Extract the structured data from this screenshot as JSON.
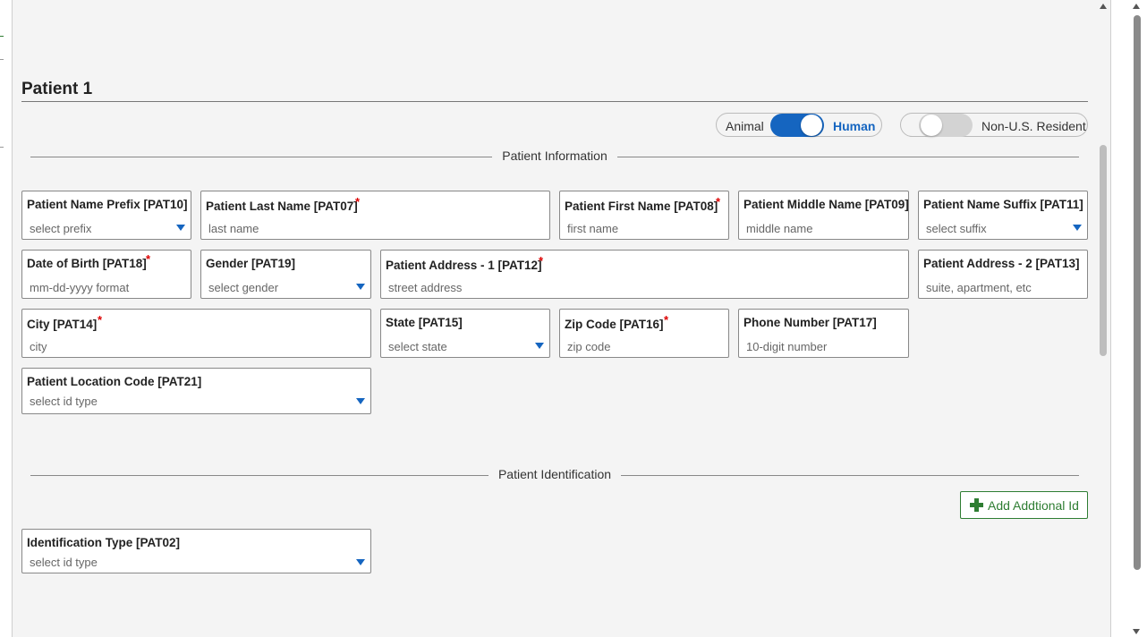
{
  "title": "Patient 1",
  "toggles": {
    "species": {
      "left_label": "Animal",
      "right_label": "Human",
      "on": true
    },
    "residency": {
      "label": "Non-U.S. Resident",
      "on": false
    }
  },
  "sections": {
    "info": "Patient Information",
    "identification": "Patient Identification"
  },
  "fields": {
    "prefix": {
      "label": "Patient Name Prefix [PAT10]",
      "placeholder": "select prefix",
      "required": false
    },
    "last_name": {
      "label": "Patient Last Name [PAT07]",
      "placeholder": "last name",
      "required": true
    },
    "first_name": {
      "label": "Patient First Name [PAT08]",
      "placeholder": "first name",
      "required": true
    },
    "middle_name": {
      "label": "Patient Middle Name [PAT09]",
      "placeholder": "middle name",
      "required": false
    },
    "suffix": {
      "label": "Patient Name Suffix [PAT11]",
      "placeholder": "select suffix",
      "required": false
    },
    "dob": {
      "label": "Date of Birth [PAT18]",
      "placeholder": "mm-dd-yyyy format",
      "required": true
    },
    "gender": {
      "label": "Gender [PAT19]",
      "placeholder": "select gender",
      "required": false
    },
    "address1": {
      "label": "Patient Address - 1 [PAT12]",
      "placeholder": "street address",
      "required": true
    },
    "address2": {
      "label": "Patient Address - 2 [PAT13]",
      "placeholder": "suite, apartment, etc",
      "required": false
    },
    "city": {
      "label": "City [PAT14]",
      "placeholder": "city",
      "required": true
    },
    "state": {
      "label": "State [PAT15]",
      "placeholder": "select state",
      "required": false
    },
    "zip": {
      "label": "Zip Code [PAT16]",
      "placeholder": "zip code",
      "required": true
    },
    "phone": {
      "label": "Phone Number [PAT17]",
      "placeholder": "10-digit number",
      "required": false
    },
    "location_code": {
      "label": "Patient Location Code [PAT21]",
      "placeholder": "select id type",
      "required": false
    },
    "id_type": {
      "label": "Identification Type [PAT02]",
      "placeholder": "select id type",
      "required": false
    }
  },
  "add_id_button": "Add Addtional Id",
  "required_mark": "*",
  "colors": {
    "accent": "#1565c0",
    "toggle_on": "#1565c0",
    "toggle_off": "#d3d3d3",
    "required": "#dd0000",
    "add_button": "#2e7d32"
  }
}
